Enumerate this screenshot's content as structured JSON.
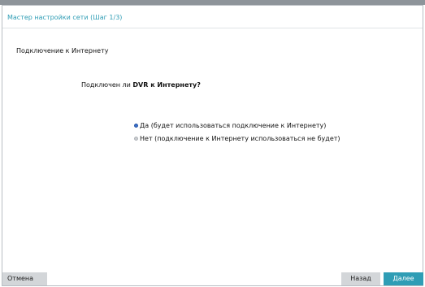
{
  "dialog": {
    "title_prefix": "Мастер настройки сети",
    "step": "(Шаг 1/3)"
  },
  "section": {
    "title": "Подключение к Интернету"
  },
  "question": {
    "prefix": "Подключен ли ",
    "emphasis": "DVR",
    "suffix": " к Интернету?"
  },
  "options": [
    {
      "label": "Да (будет использоваться подключение к Интернету)",
      "selected": true
    },
    {
      "label": "Нет (подключение к Интернету использоваться не будет)",
      "selected": false
    }
  ],
  "buttons": {
    "cancel": "Отмена",
    "back": "Назад",
    "next": "Далее"
  },
  "colors": {
    "accent": "#2f9db5",
    "radio_selected": "#3a6fc9"
  }
}
